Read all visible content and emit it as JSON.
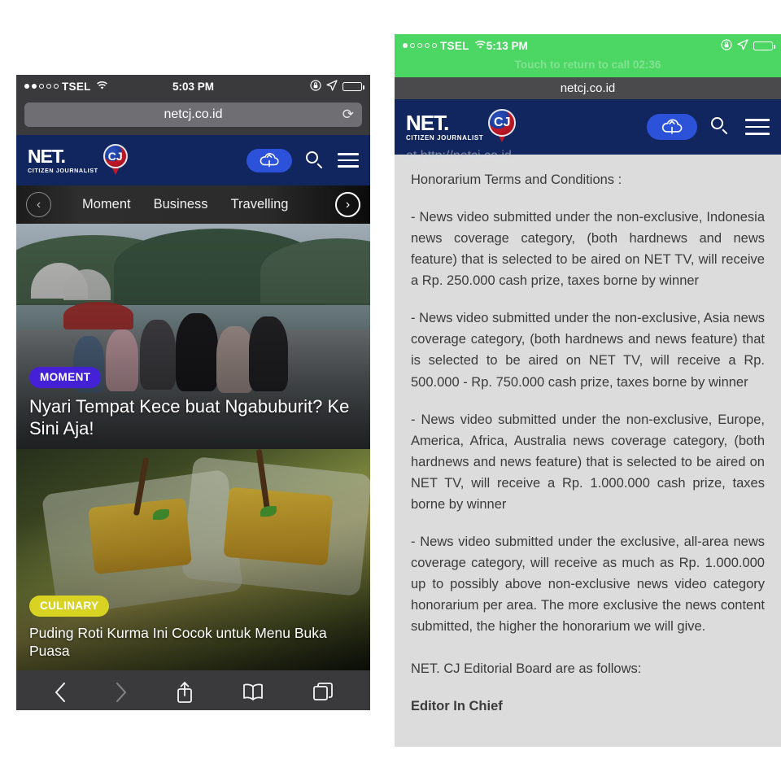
{
  "left_phone": {
    "status": {
      "carrier": "TSEL",
      "signal_dots": [
        true,
        true,
        false,
        false,
        false
      ],
      "wifi_icon": "wifi-icon",
      "time": "5:03 PM",
      "rotation_lock_icon": "rotation-lock-icon",
      "location_icon": "location-arrow-icon",
      "battery_icon": "battery-low-icon",
      "battery_level_pct": 22
    },
    "browser": {
      "url": "netcj.co.id",
      "reload_glyph": "⟳"
    },
    "site_header": {
      "logo_main": "NET.",
      "logo_sub": "CITIZEN JOURNALIST",
      "pin_letters": "CJ",
      "upload_icon": "cloud-upload-icon",
      "search_icon": "search-icon",
      "menu_icon": "hamburger-menu-icon",
      "upload_button_color": "#2b52d8",
      "header_color": "#11255e"
    },
    "category_nav": {
      "prev_glyph": "‹",
      "next_glyph": "›",
      "items": [
        "Moment",
        "Business",
        "Travelling"
      ]
    },
    "cards": [
      {
        "badge": "MOMENT",
        "badge_color": "#4420d6",
        "headline": "Nyari Tempat Kece buat Ngabuburit? Ke Sini Aja!",
        "image_alt": "people sitting on a lakeside terrace with hills"
      },
      {
        "badge": "CULINARY",
        "badge_color": "#d8d222",
        "badge_text_color": "#ffffff",
        "headline": "Puding Roti Kurma Ini Cocok untuk Menu Buka Puasa",
        "image_alt": "yellow date bread pudding on a white plate"
      }
    ],
    "toolbar": {
      "back_glyph": "‹",
      "forward_glyph": "›",
      "back_name": "back-button",
      "forward_name": "forward-button",
      "share_name": "share-button",
      "bookmarks_name": "bookmarks-button",
      "tabs_name": "tabs-button"
    }
  },
  "right_phone": {
    "status": {
      "carrier": "TSEL",
      "signal_dots": [
        true,
        false,
        false,
        false,
        false
      ],
      "wifi_icon": "wifi-icon",
      "time": "5:13 PM",
      "rotation_lock_icon": "rotation-lock-icon",
      "location_icon": "location-arrow-icon",
      "battery_icon": "battery-icon",
      "battery_level_pct": 35,
      "call_banner": "Touch to return to call 02:36",
      "banner_color": "#4cd663"
    },
    "browser": {
      "url": "netcj.co.id"
    },
    "site_header": {
      "logo_main": "NET.",
      "logo_sub": "CITIZEN JOURNALIST",
      "pin_letters": "CJ",
      "upload_icon": "cloud-upload-icon",
      "search_icon": "search-icon",
      "menu_icon": "hamburger-menu-icon"
    },
    "article": {
      "clipped_line": "at http://netcj.co.id",
      "paragraphs": [
        "Honorarium Terms and Conditions :",
        "- News video submitted under the non-exclusive,  Indonesia news coverage category, (both hardnews and news feature) that is selected to  be aired on NET TV, will receive a Rp. 250.000 cash prize, taxes borne by winner",
        "- News video submitted under the non-exclusive,  Asia news coverage category, (both hardnews and news feature) that is selected to be aired on NET TV, will receive a Rp. 500.000 - Rp. 750.000 cash prize, taxes borne by winner",
        "- News video submitted under the non-exclusive, Europe, America, Africa, Australia news coverage category, (both hardnews and news feature) that is selected to be aired on NET TV, will receive a Rp. 1.000.000 cash prize, taxes borne by winner",
        "- News video submitted under the exclusive, all-area news coverage category, will receive as much as Rp. 1.000.000 up to possibly above non-exclusive news video category honorarium per area. The more exclusive the news content submitted, the higher the honorarium we will give.",
        "NET. CJ Editorial Board are as follows:"
      ],
      "board_heading": "Editor In Chief"
    }
  }
}
